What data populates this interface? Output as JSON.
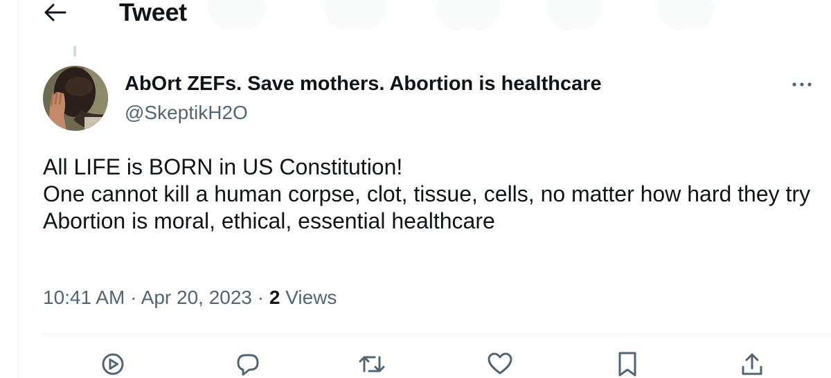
{
  "header": {
    "title": "Tweet",
    "back_icon": "arrow-left-icon"
  },
  "tweet": {
    "author": {
      "display_name": "AbOrt ZEFs. Save mothers. Abortion is healthcare",
      "handle": "@SkeptikH2O"
    },
    "text_lines": [
      "All LIFE is BORN in US Constitution!",
      "One cannot kill a human corpse, clot, tissue, cells, no matter how hard they try",
      "Abortion is moral, ethical, essential healthcare"
    ],
    "time": "10:41 AM",
    "date": "Apr 20, 2023",
    "separator": "·",
    "views_count": "2",
    "views_label": "Views"
  },
  "actions": [
    {
      "name": "play",
      "icon": "play-icon"
    },
    {
      "name": "reply",
      "icon": "reply-icon"
    },
    {
      "name": "retweet",
      "icon": "retweet-icon"
    },
    {
      "name": "like",
      "icon": "heart-icon"
    },
    {
      "name": "bookmark",
      "icon": "bookmark-icon"
    },
    {
      "name": "share",
      "icon": "share-icon"
    }
  ],
  "colors": {
    "text_primary": "#0f1419",
    "text_secondary": "#536471",
    "border": "#eff3f4",
    "thread_line": "#cfd9de"
  }
}
